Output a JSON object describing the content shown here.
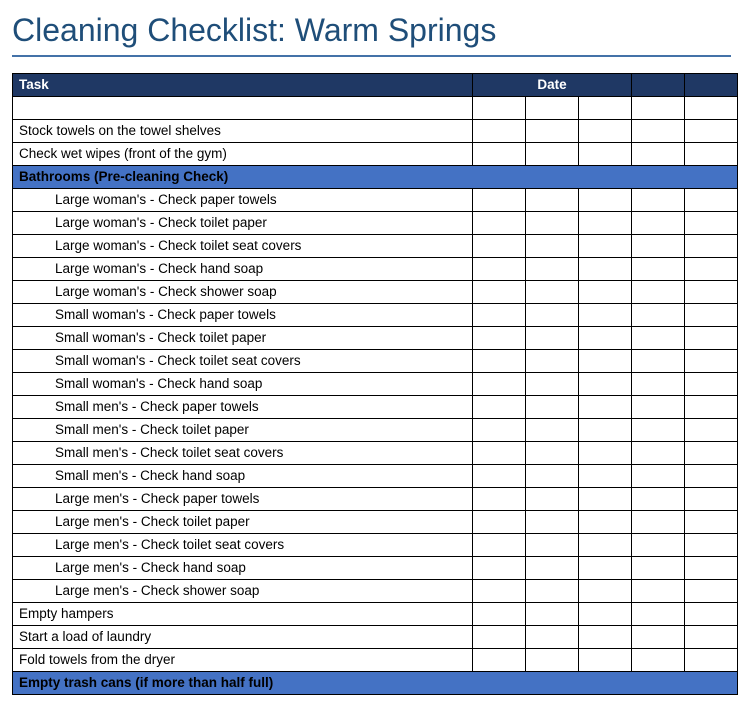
{
  "title": "Cleaning Checklist: Warm Springs",
  "headers": {
    "task": "Task",
    "date": "Date"
  },
  "rows": [
    {
      "type": "blank",
      "text": ""
    },
    {
      "type": "task",
      "text": "Stock towels on the towel shelves"
    },
    {
      "type": "task",
      "text": "Check wet wipes (front of the gym)"
    },
    {
      "type": "section",
      "text": "Bathrooms (Pre-cleaning Check)"
    },
    {
      "type": "sub",
      "text": "Large woman's - Check paper towels"
    },
    {
      "type": "sub",
      "text": "Large woman's - Check toilet paper"
    },
    {
      "type": "sub",
      "text": "Large woman's - Check toilet seat covers"
    },
    {
      "type": "sub",
      "text": "Large woman's - Check hand soap"
    },
    {
      "type": "sub",
      "text": "Large woman's - Check shower soap"
    },
    {
      "type": "sub",
      "text": "Small woman's - Check paper towels"
    },
    {
      "type": "sub",
      "text": "Small woman's - Check toilet paper"
    },
    {
      "type": "sub",
      "text": "Small woman's - Check toilet seat covers"
    },
    {
      "type": "sub",
      "text": "Small woman's - Check hand soap"
    },
    {
      "type": "sub",
      "text": "Small men's - Check paper towels"
    },
    {
      "type": "sub",
      "text": "Small men's - Check toilet paper"
    },
    {
      "type": "sub",
      "text": "Small men's - Check toilet seat covers"
    },
    {
      "type": "sub",
      "text": "Small men's - Check hand soap"
    },
    {
      "type": "sub",
      "text": "Large men's - Check paper towels"
    },
    {
      "type": "sub",
      "text": "Large men's - Check toilet paper"
    },
    {
      "type": "sub",
      "text": "Large men's - Check toilet seat covers"
    },
    {
      "type": "sub",
      "text": "Large men's - Check hand soap"
    },
    {
      "type": "sub",
      "text": "Large men's - Check shower soap"
    },
    {
      "type": "task",
      "text": "Empty hampers"
    },
    {
      "type": "task",
      "text": "Start a load of laundry"
    },
    {
      "type": "task",
      "text": "Fold towels from the dryer"
    },
    {
      "type": "section",
      "text": "Empty trash cans (if more than half full)"
    }
  ]
}
